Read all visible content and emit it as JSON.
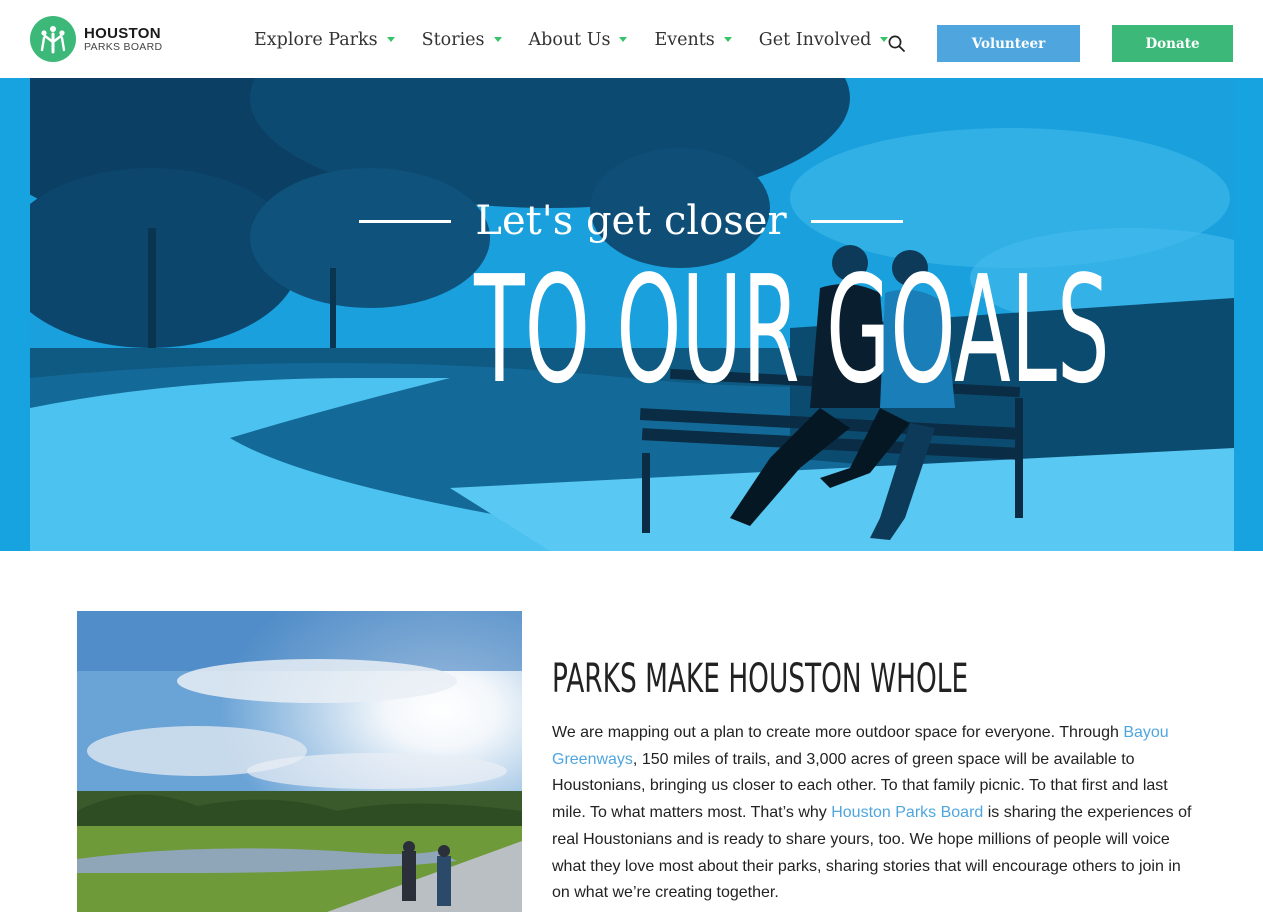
{
  "header": {
    "logo": {
      "title": "HOUSTON",
      "subtitle": "PARKS BOARD"
    },
    "nav": [
      {
        "label": "Explore Parks"
      },
      {
        "label": "Stories"
      },
      {
        "label": "About Us"
      },
      {
        "label": "Events"
      },
      {
        "label": "Get Involved"
      }
    ],
    "search_icon": "search-icon",
    "volunteer_label": "Volunteer",
    "donate_label": "Donate"
  },
  "hero": {
    "kicker": "Let's get closer",
    "title": "TO OUR GOALS"
  },
  "intro": {
    "title": "PARKS MAKE HOUSTON WHOLE",
    "p1": "We are mapping out a plan to create more outdoor space for everyone. Through ",
    "link1": "Bayou Greenways",
    "p2": ", 150 miles of trails, and 3,000 acres of green space will be available to Houstonians, bringing us closer to each other. To that family picnic. To that first and last mile. To what matters most. That’s why ",
    "link2": "Houston Parks Board",
    "p3": " is sharing the experiences of real Houstonians and is ready to share yours, too. We hope millions of people will voice what they love most about their parks, sharing stories that will encourage others to join in on what we’re creating together."
  },
  "colors": {
    "brand_green": "#3cb878",
    "brand_blue": "#4fa6df",
    "hero_blue": "#16a3e0",
    "nav_caret": "#37c26b"
  }
}
